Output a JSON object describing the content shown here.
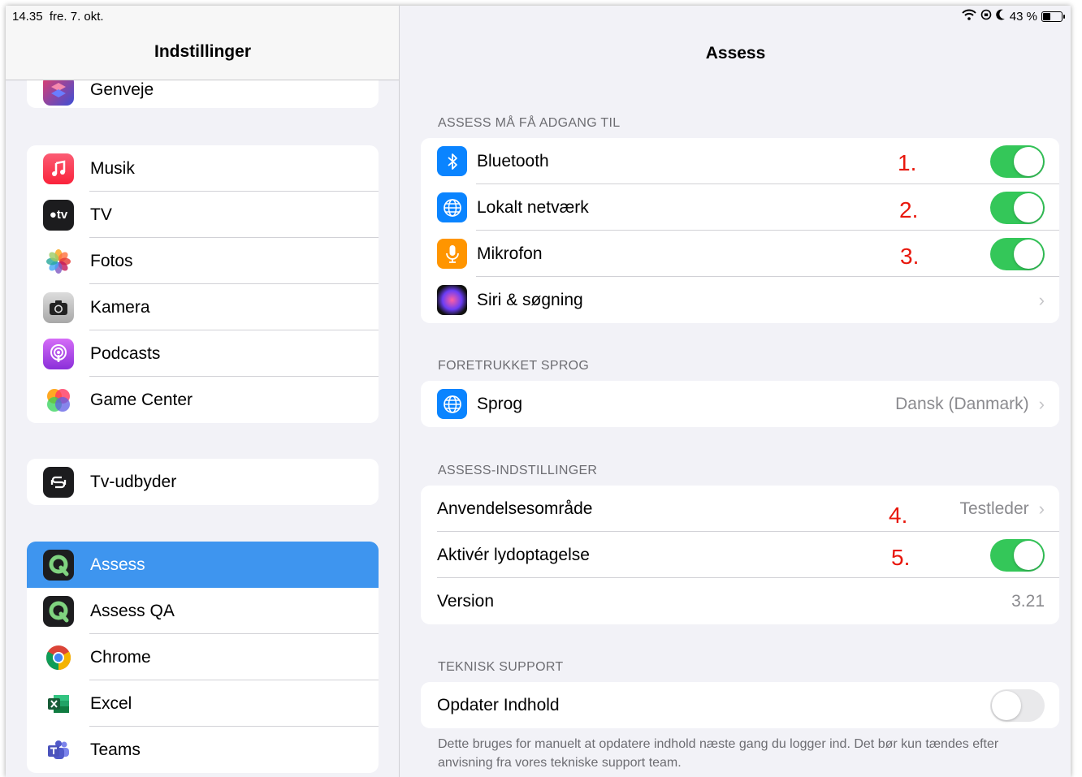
{
  "status_bar": {
    "time": "14.35",
    "date": "fre. 7. okt.",
    "battery": "43 %",
    "battery_level": 0.43
  },
  "sidebar": {
    "title": "Indstillinger",
    "partial_item": {
      "label": "Genveje",
      "icon": "shortcuts-icon"
    },
    "groups": [
      [
        {
          "label": "Musik",
          "icon": "music-icon"
        },
        {
          "label": "TV",
          "icon": "tv-icon"
        },
        {
          "label": "Fotos",
          "icon": "photos-icon"
        },
        {
          "label": "Kamera",
          "icon": "camera-icon"
        },
        {
          "label": "Podcasts",
          "icon": "podcasts-icon"
        },
        {
          "label": "Game Center",
          "icon": "game-center-icon"
        }
      ],
      [
        {
          "label": "Tv-udbyder",
          "icon": "tv-provider-icon"
        }
      ],
      [
        {
          "label": "Assess",
          "icon": "assess-icon",
          "active": true
        },
        {
          "label": "Assess QA",
          "icon": "assess-qa-icon"
        },
        {
          "label": "Chrome",
          "icon": "chrome-icon"
        },
        {
          "label": "Excel",
          "icon": "excel-icon"
        },
        {
          "label": "Teams",
          "icon": "teams-icon"
        }
      ]
    ]
  },
  "detail": {
    "title": "Assess",
    "sections": {
      "access": {
        "header": "ASSESS MÅ FÅ ADGANG TIL",
        "rows": [
          {
            "label": "Bluetooth",
            "icon": "bluetooth-icon",
            "toggle": true,
            "annotation": "1."
          },
          {
            "label": "Lokalt netværk",
            "icon": "local-network-icon",
            "toggle": true,
            "annotation": "2."
          },
          {
            "label": "Mikrofon",
            "icon": "microphone-icon",
            "toggle": true,
            "annotation": "3."
          },
          {
            "label": "Siri & søgning",
            "icon": "siri-icon",
            "chevron": true
          }
        ]
      },
      "language": {
        "header": "FORETRUKKET SPROG",
        "rows": [
          {
            "label": "Sprog",
            "icon": "language-icon",
            "value": "Dansk (Danmark)",
            "chevron": true
          }
        ]
      },
      "settings": {
        "header": "ASSESS-INDSTILLINGER",
        "rows": [
          {
            "label": "Anvendelsesområde",
            "value": "Testleder",
            "chevron": true,
            "annotation": "4."
          },
          {
            "label": "Aktivér lydoptagelse",
            "toggle": true,
            "annotation": "5."
          },
          {
            "label": "Version",
            "value": "3.21"
          }
        ]
      },
      "support": {
        "header": "TEKNISK SUPPORT",
        "rows": [
          {
            "label": "Opdater Indhold",
            "toggle": false
          }
        ],
        "footer": "Dette bruges for manuelt at opdatere indhold næste gang du logger ind. Det bør kun tændes efter anvisning fra vores tekniske support team."
      }
    }
  },
  "colors": {
    "accent": "#3e95ef",
    "toggle_on": "#34c759",
    "annotation": "#e8170c"
  }
}
